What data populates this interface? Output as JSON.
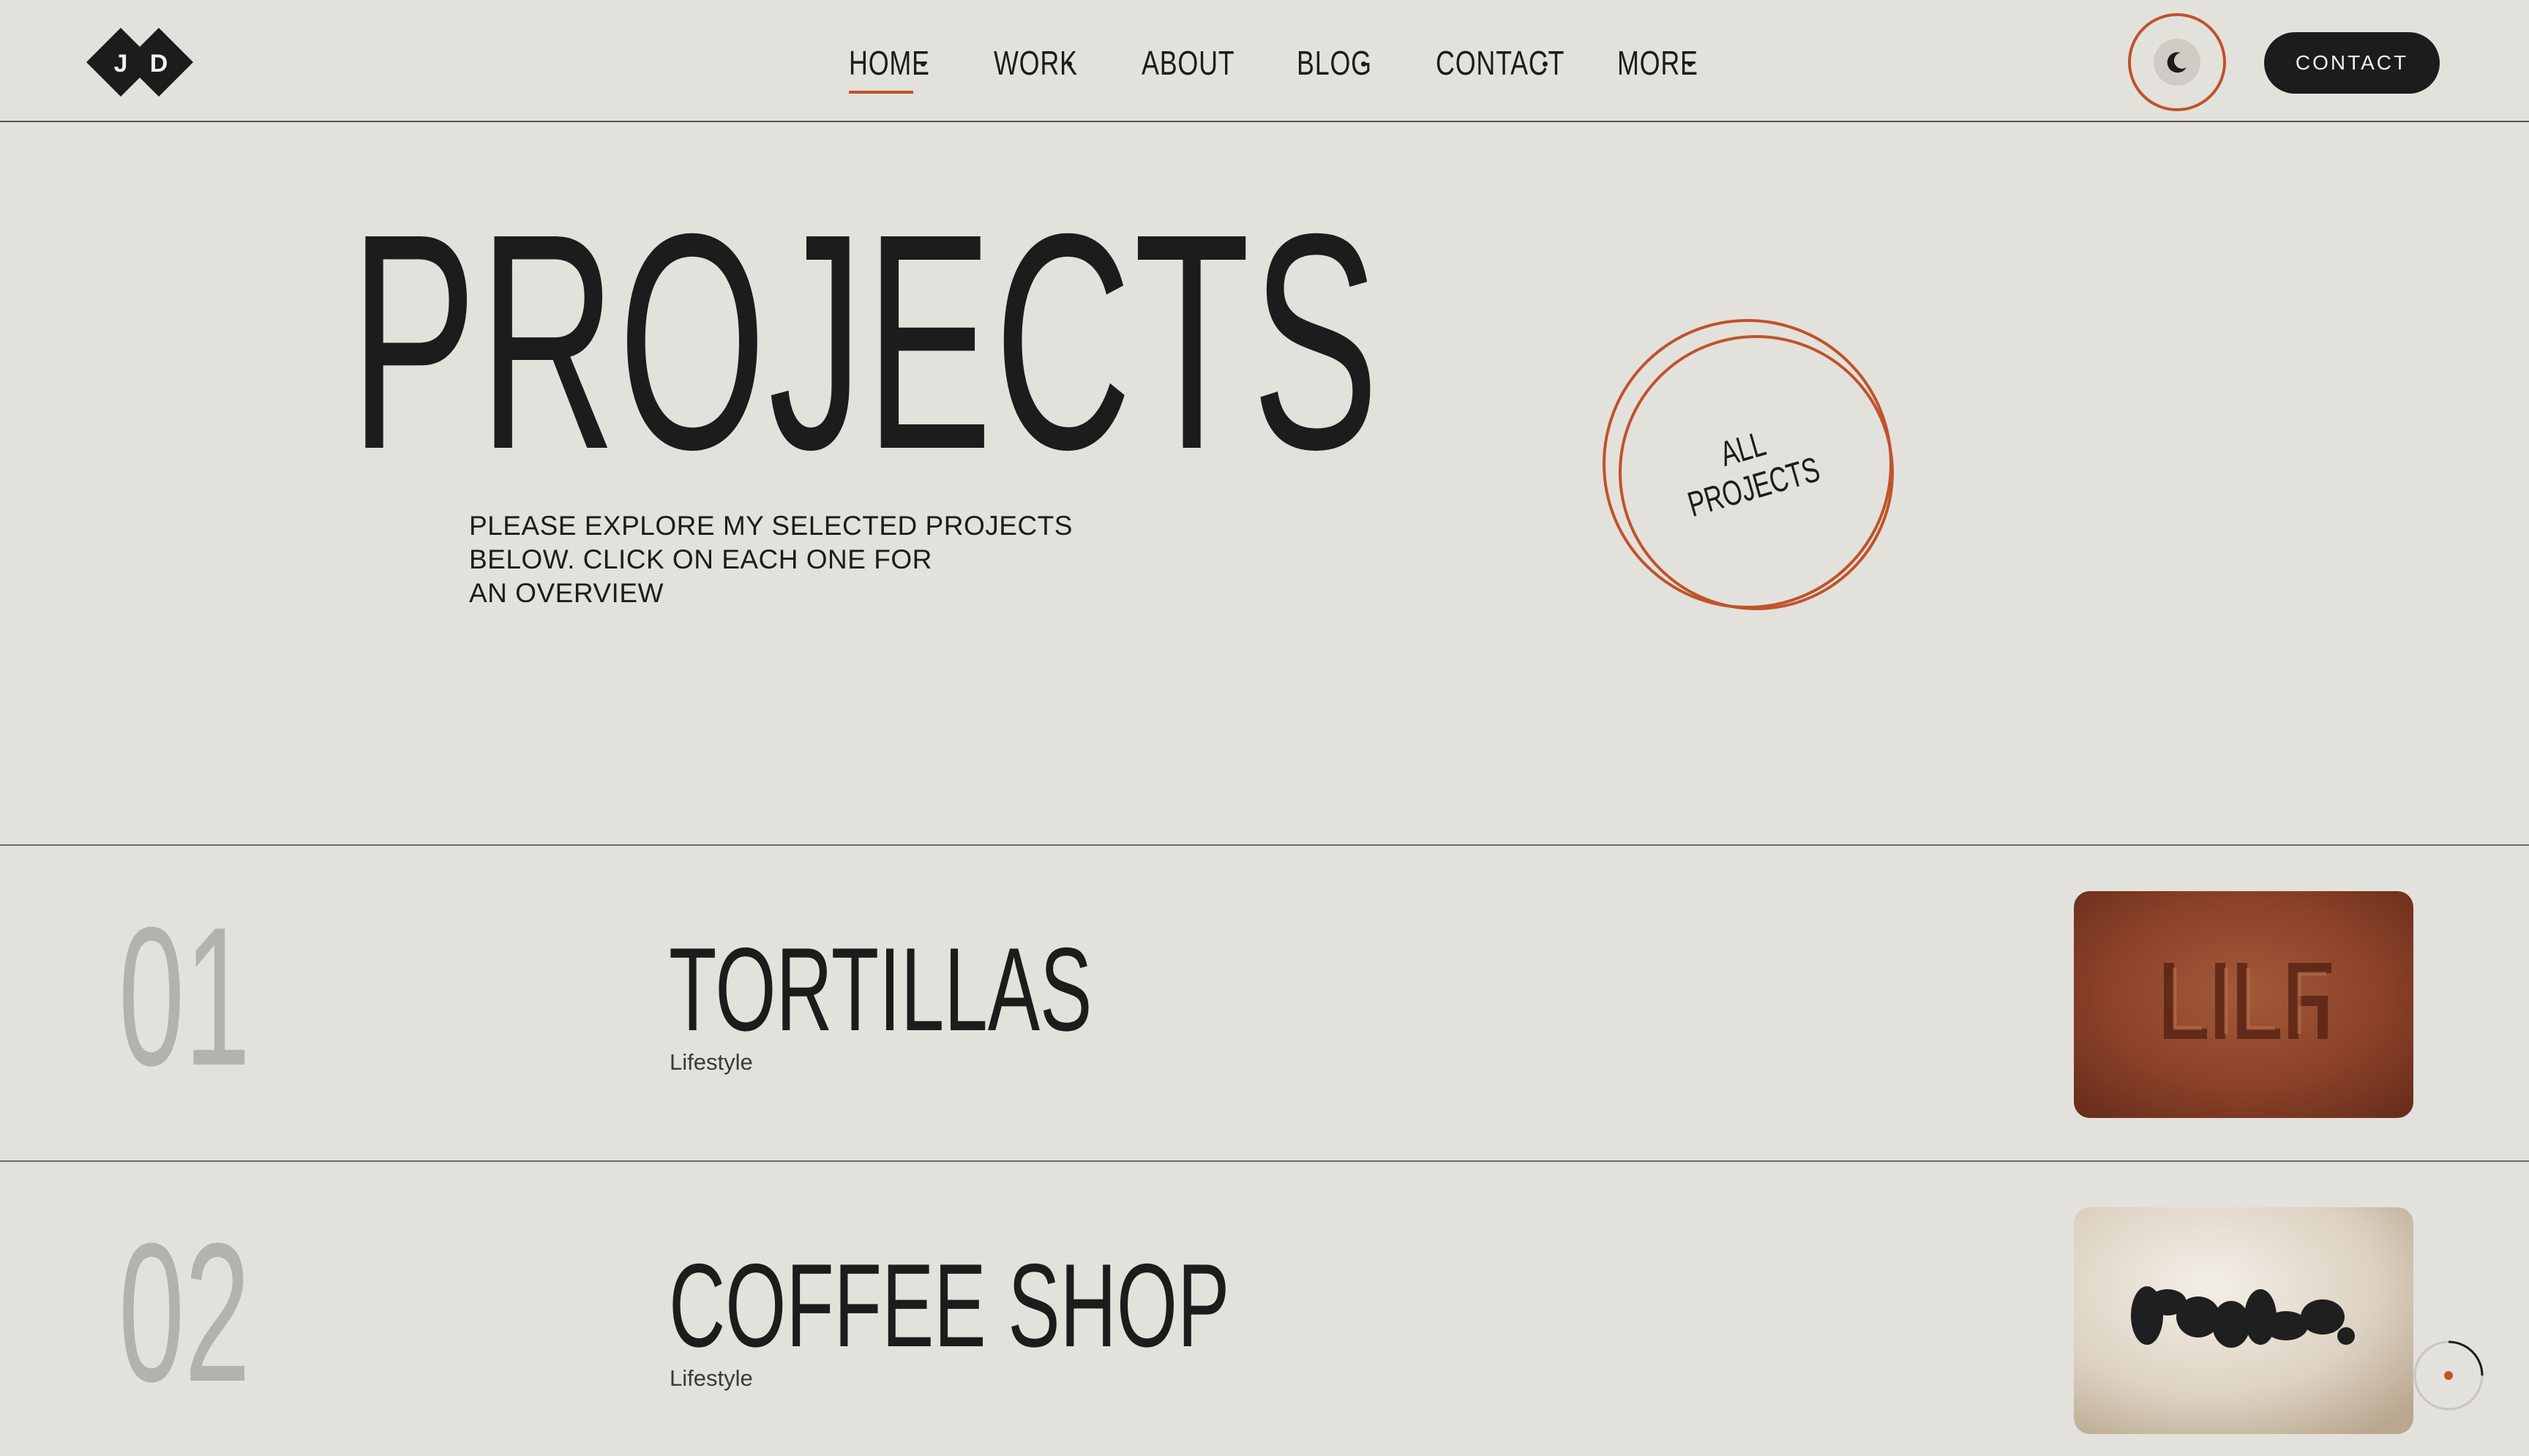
{
  "brand": {
    "logo_letters": [
      "J",
      "D"
    ]
  },
  "nav": {
    "items": [
      {
        "label": "HOME",
        "has_dropdown": true,
        "active": true
      },
      {
        "label": "WORK",
        "has_dropdown": true,
        "active": false
      },
      {
        "label": "ABOUT",
        "has_dropdown": false,
        "active": false
      },
      {
        "label": "BLOG",
        "has_dropdown": true,
        "active": false
      },
      {
        "label": "CONTACT",
        "has_dropdown": true,
        "active": false
      },
      {
        "label": "MORE",
        "has_dropdown": true,
        "active": false
      }
    ],
    "theme_toggle_icon": "moon-icon",
    "contact_button_label": "CONTACT"
  },
  "hero": {
    "title": "PROJECTS",
    "description_lines": [
      "PLEASE EXPLORE MY SELECTED PROJECTS",
      "BELOW. CLICK ON EACH ONE FOR",
      "AN OVERVIEW"
    ],
    "all_projects_line1": "ALL",
    "all_projects_line2": "PROJECTS"
  },
  "projects": [
    {
      "number": "01",
      "title": "TORTILLAS",
      "category": "Lifestyle",
      "thumb_text": "LILA"
    },
    {
      "number": "02",
      "title": "COFFEE SHOP",
      "category": "Lifestyle",
      "thumb_text": "ROKO"
    }
  ],
  "colors": {
    "background": "#e3e1dc",
    "text": "#1c1c1c",
    "accent": "#c0532a",
    "muted_number": "#b4b2ad",
    "button_bg": "#1c1c1c"
  }
}
